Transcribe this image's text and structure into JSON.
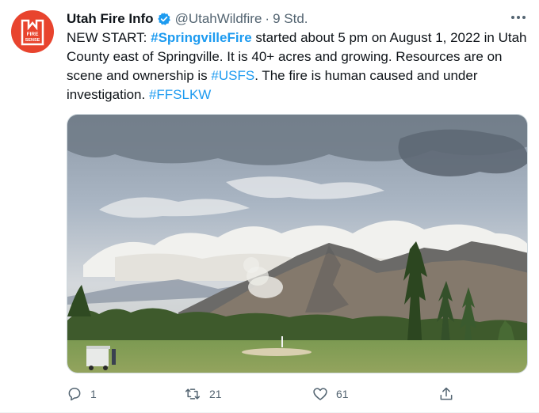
{
  "tweet": {
    "display_name": "Utah Fire Info",
    "handle": "@UtahWildfire",
    "separator": "·",
    "time": "9 Std.",
    "avatar_logo_text": "FIRE SENSE",
    "text_parts": {
      "p1": "NEW START: ",
      "tag1": "#SpringvilleFire",
      "p2": " started about 5 pm on August 1, 2022 in Utah County east of Springville. It is 40+ acres and growing. Resources are on scene and ownership is ",
      "tag2": "#USFS",
      "p3": ". The fire is human caused and under investigation. ",
      "tag3": "#FFSLKW"
    },
    "actions": {
      "replies": "1",
      "retweets": "21",
      "likes": "61"
    }
  },
  "icons": {
    "verified": "verified-badge-icon",
    "more": "more-dots-icon",
    "reply": "reply-bubble-icon",
    "retweet": "retweet-icon",
    "like": "heart-icon",
    "share": "share-icon"
  },
  "colors": {
    "link": "#1d9bf0",
    "secondary": "#536471",
    "avatar_bg": "#e8442e"
  }
}
